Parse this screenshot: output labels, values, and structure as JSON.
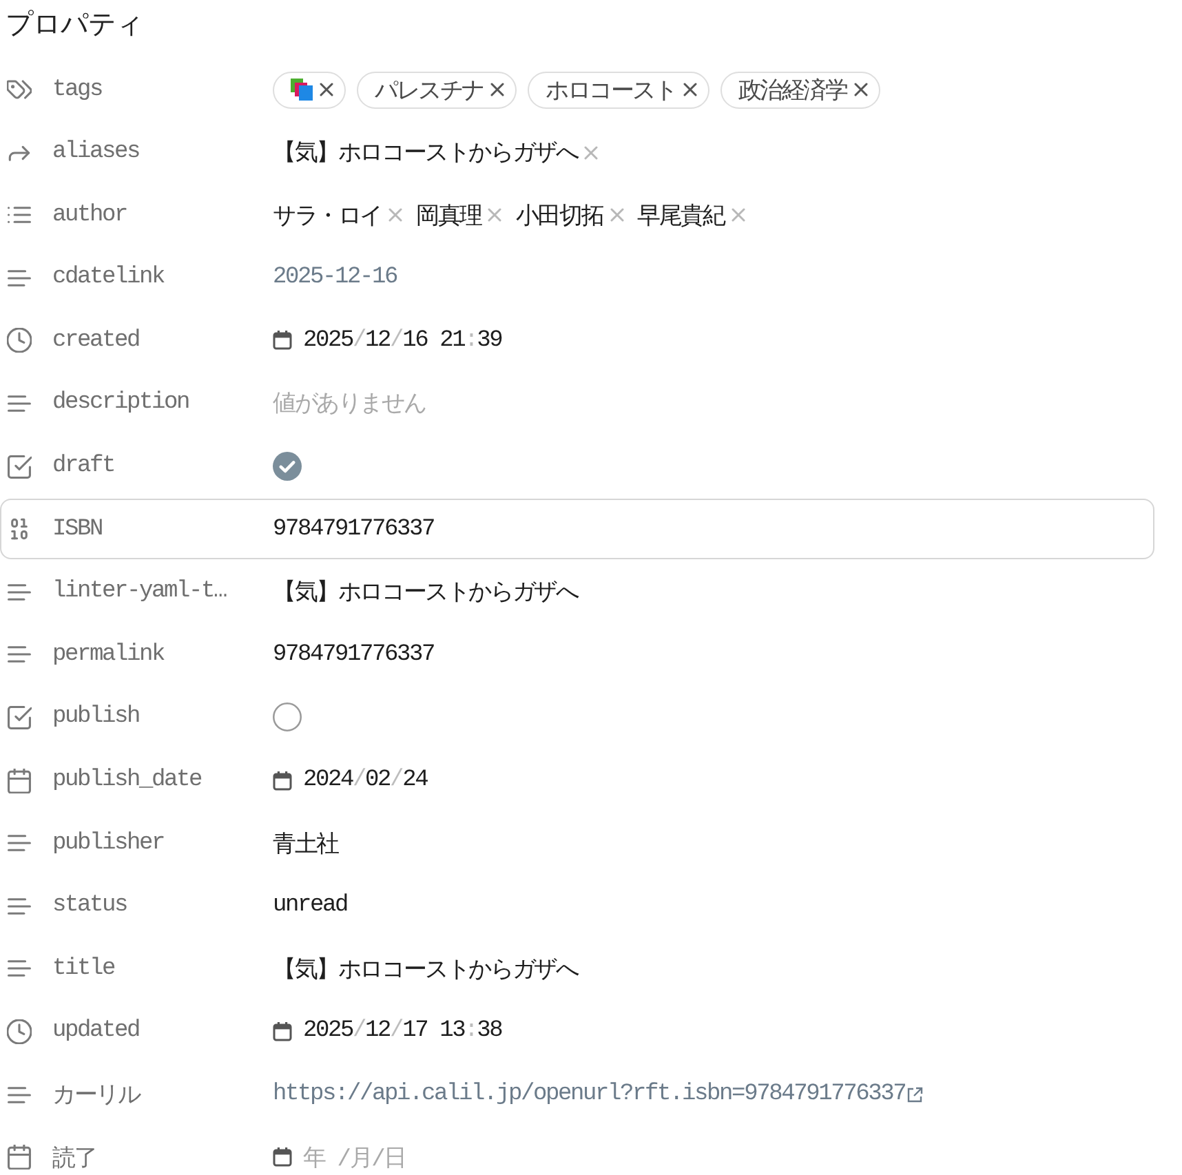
{
  "title": "プロパティ",
  "properties": [
    {
      "kind": "tags",
      "label": "tags",
      "focused": false,
      "tags": [
        {
          "kind": "icon"
        },
        {
          "kind": "text",
          "label": "パレスチナ"
        },
        {
          "kind": "text",
          "label": "ホロコースト"
        },
        {
          "kind": "text",
          "label": "政治経済学"
        }
      ]
    },
    {
      "kind": "aliases",
      "label": "aliases",
      "focused": false,
      "items": [
        "【気】ホロコーストからガザへ"
      ]
    },
    {
      "kind": "multitext",
      "label": "author",
      "focused": false,
      "items": [
        "サラ・ロイ",
        "岡真理",
        "小田切拓",
        "早尾貴紀"
      ]
    },
    {
      "kind": "link",
      "label": "cdatelink",
      "focused": false,
      "value": "2025-12-16"
    },
    {
      "kind": "datetime",
      "label": "created",
      "focused": false,
      "value": "2025/12/16 21:39"
    },
    {
      "kind": "text",
      "label": "description",
      "focused": false,
      "placeholder": "値がありません"
    },
    {
      "kind": "checkbox",
      "label": "draft",
      "focused": false,
      "checked": true
    },
    {
      "kind": "number",
      "label": "ISBN",
      "focused": true,
      "value": "9784791776337"
    },
    {
      "kind": "text",
      "label": "linter-yaml-t…",
      "focused": false,
      "value": "【気】ホロコーストからガザへ"
    },
    {
      "kind": "text",
      "label": "permalink",
      "focused": false,
      "value": "9784791776337"
    },
    {
      "kind": "checkbox",
      "label": "publish",
      "focused": false,
      "checked": false
    },
    {
      "kind": "date",
      "label": "publish_date",
      "focused": false,
      "value": "2024/02/24"
    },
    {
      "kind": "text",
      "label": "publisher",
      "focused": false,
      "value": "青土社"
    },
    {
      "kind": "text",
      "label": "status",
      "focused": false,
      "value": "unread"
    },
    {
      "kind": "text",
      "label": "title",
      "focused": false,
      "value": "【気】ホロコーストからガザへ"
    },
    {
      "kind": "datetime",
      "label": "updated",
      "focused": false,
      "value": "2025/12/17 13:38"
    },
    {
      "kind": "url",
      "label": "カーリル",
      "focused": false,
      "value": "https://api.calil.jp/openurl?rft.isbn=9784791776337"
    },
    {
      "kind": "date",
      "label": "読了",
      "focused": false,
      "placeholder": "年 /月/日"
    }
  ]
}
